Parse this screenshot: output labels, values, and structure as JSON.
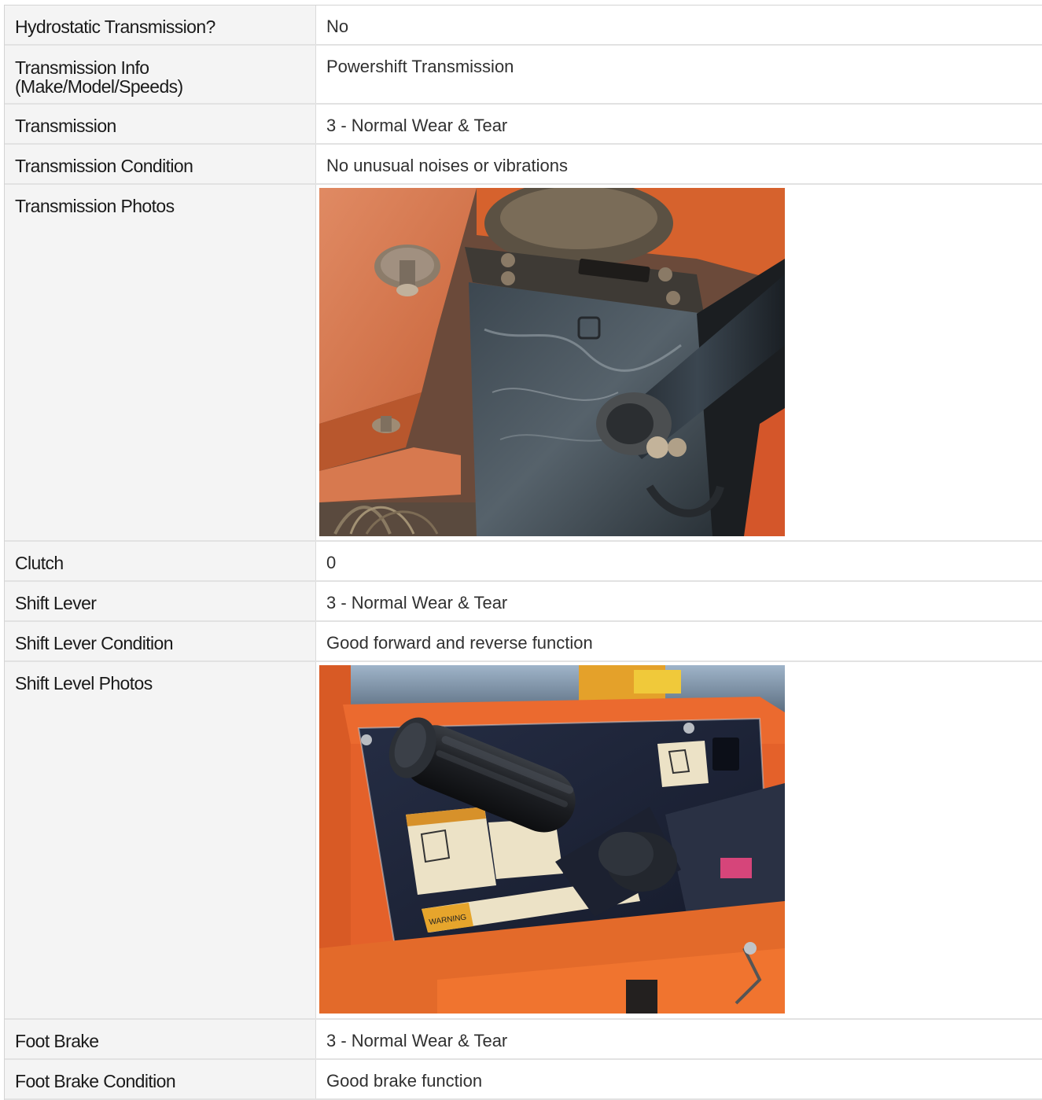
{
  "rows": [
    {
      "label": "Hydrostatic Transmission?",
      "value": "No"
    },
    {
      "label": "Transmission Info (Make/Model/Speeds)",
      "value": "Powershift Transmission"
    },
    {
      "label": "Transmission",
      "value": "3 - Normal Wear & Tear"
    },
    {
      "label": "Transmission Condition",
      "value": "No unusual noises or vibrations"
    },
    {
      "label": "Transmission Photos",
      "photo": "transmission-undercarriage-photo"
    },
    {
      "label": "Clutch",
      "value": "0"
    },
    {
      "label": "Shift Lever",
      "value": "3 - Normal Wear & Tear"
    },
    {
      "label": "Shift Lever Condition",
      "value": "Good forward and reverse function"
    },
    {
      "label": "Shift Level Photos",
      "photo": "shift-lever-joystick-photo",
      "decal_text": "WARNING"
    },
    {
      "label": "Foot Brake",
      "value": "3 - Normal Wear & Tear"
    },
    {
      "label": "Foot Brake Condition",
      "value": "Good brake function"
    }
  ]
}
